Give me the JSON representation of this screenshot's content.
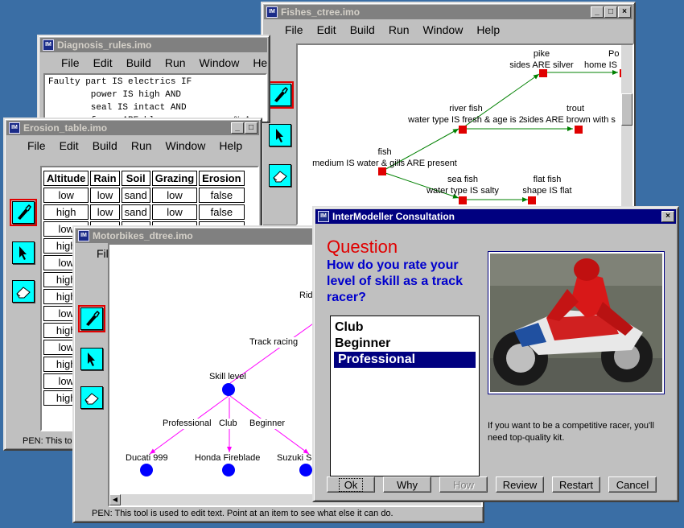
{
  "app_icon_label": "IM",
  "menus": [
    "File",
    "Edit",
    "Build",
    "Run",
    "Window",
    "Help"
  ],
  "diagnosis": {
    "title": "Diagnosis_rules.imo",
    "menus": [
      "File",
      "Edit",
      "Build",
      "Run",
      "Window",
      "He"
    ],
    "code_lines": [
      "Faulty part IS electrics IF",
      "        power IS high AND",
      "        seal IS intact AND",
      "        fuses ARE blown .          % A"
    ]
  },
  "fishes": {
    "title": "Fishes_ctree.imo",
    "nodes": {
      "fish": [
        "fish",
        "medium IS water & gills ARE present"
      ],
      "river": [
        "river fish",
        "water type IS fresh & age is 2"
      ],
      "sea": [
        "sea fish",
        "water type IS salty"
      ],
      "pike": [
        "pike",
        "sides ARE silver"
      ],
      "trout": [
        "trout",
        "sides ARE brown with s"
      ],
      "flat": [
        "flat fish",
        "shape IS flat"
      ],
      "po": [
        "Po",
        "home IS"
      ]
    }
  },
  "erosion": {
    "title": "Erosion_table.imo",
    "headers": [
      "Altitude",
      "Rain",
      "Soil",
      "Grazing",
      "Erosion"
    ],
    "rows": [
      [
        "low",
        "low",
        "sand",
        "low",
        "false"
      ],
      [
        "high",
        "low",
        "sand",
        "low",
        "false"
      ]
    ],
    "col1": [
      "low",
      "high",
      "low",
      "high",
      "high",
      "low",
      "high",
      "low",
      "high",
      "low",
      "high"
    ],
    "status": "PEN: This tool"
  },
  "motorbikes": {
    "title": "Motorbikes_dtree.imo",
    "nodes": {
      "ride": "Rid",
      "skill": "Skill level",
      "ducati": "Ducati 999",
      "honda": "Honda Fireblade",
      "suzuki": "Suzuki S"
    },
    "edges": {
      "track": "Track racing",
      "professional": "Professional",
      "club": "Club",
      "beginner": "Beginner"
    },
    "status": "PEN: This tool is used to edit text. Point at an item to see what else it can do."
  },
  "consult": {
    "title": "InterModeller Consultation",
    "heading": "Question",
    "question": "How do you rate your level of skill as a track racer?",
    "options": [
      "Club",
      "Beginner",
      "Professional"
    ],
    "selected_index": 2,
    "info": "If you want to be a competitive racer, you'll need top-quality kit.",
    "buttons": {
      "ok": "Ok",
      "why": "Why",
      "how": "How",
      "review": "Review",
      "restart": "Restart",
      "cancel": "Cancel"
    }
  },
  "colors": {
    "accent_question": "#e00000",
    "question_text": "#0000cc",
    "node_fish": "#e00000",
    "edge_fish": "#008000",
    "node_bike": "#0000ff",
    "edge_bike": "#ff00ff"
  }
}
